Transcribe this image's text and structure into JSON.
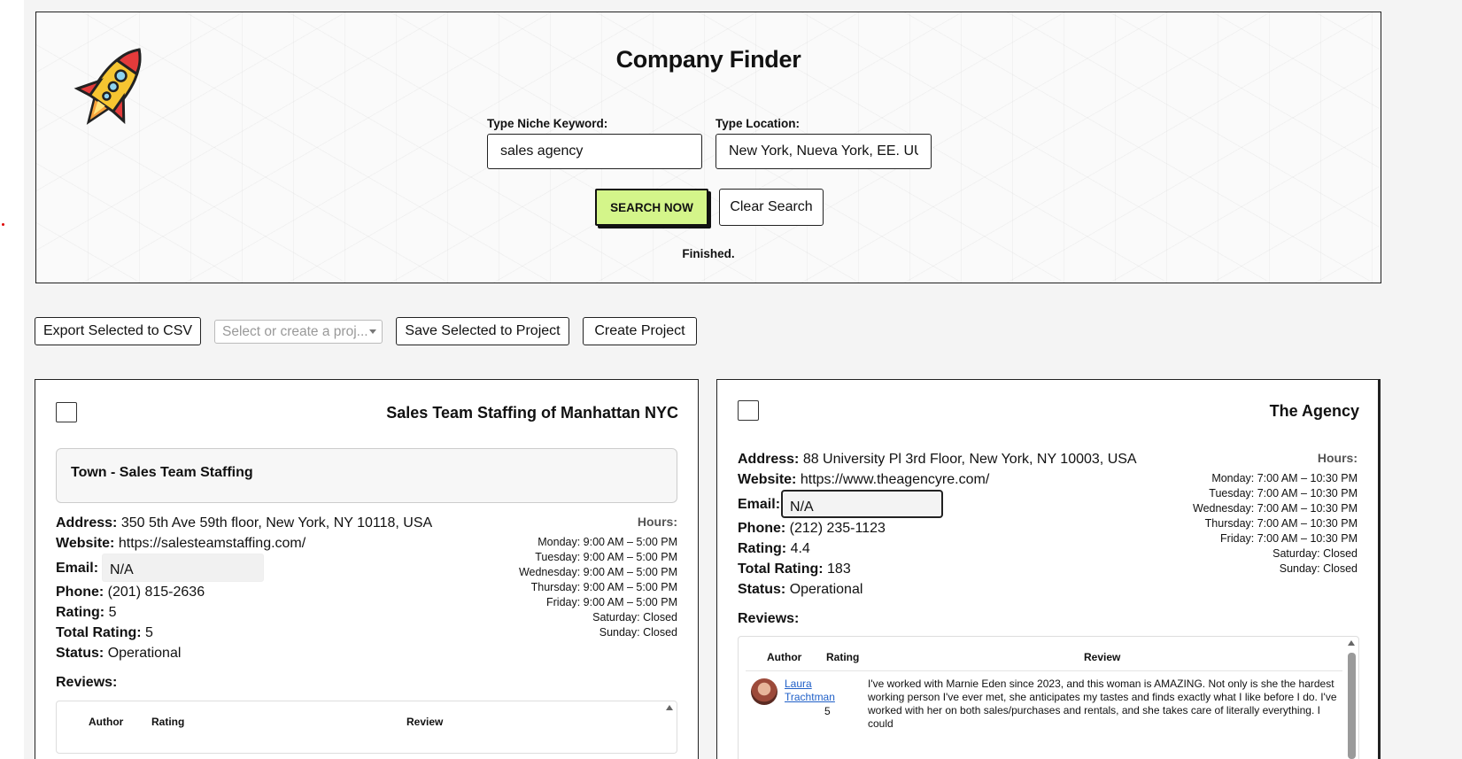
{
  "header": {
    "title": "Company Finder",
    "keyword_label": "Type Niche Keyword:",
    "keyword_value": "sales agency",
    "location_label": "Type Location:",
    "location_value": "New York, Nueva York, EE. UU.",
    "search_button": "SEARCH NOW",
    "clear_button": "Clear Search",
    "status": "Finished.",
    "logo_icon": "rocket-icon"
  },
  "toolbar": {
    "export_button": "Export Selected to CSV",
    "project_placeholder": "Select or create a proj...",
    "save_button": "Save Selected to Project",
    "create_button": "Create Project"
  },
  "labels": {
    "address": "Address:",
    "website": "Website:",
    "email": "Email:",
    "phone": "Phone:",
    "rating": "Rating:",
    "total_rating": "Total Rating:",
    "status": "Status:",
    "hours": "Hours:",
    "reviews": "Reviews:",
    "col_author": "Author",
    "col_rating": "Rating",
    "col_review": "Review"
  },
  "companies": [
    {
      "name": "Sales Team Staffing of Manhattan NYC",
      "town": "Town - Sales Team Staffing",
      "address": "350 5th Ave 59th floor, New York, NY 10118, USA",
      "website": "https://salesteamstaffing.com/",
      "email": "N/A",
      "phone": "(201) 815-2636",
      "rating": "5",
      "total_rating": "5",
      "status": "Operational",
      "hours": [
        "Monday: 9:00 AM – 5:00 PM",
        "Tuesday: 9:00 AM – 5:00 PM",
        "Wednesday: 9:00 AM – 5:00 PM",
        "Thursday: 9:00 AM – 5:00 PM",
        "Friday: 9:00 AM – 5:00 PM",
        "Saturday: Closed",
        "Sunday: Closed"
      ]
    },
    {
      "name": "The Agency",
      "address": "88 University Pl 3rd Floor, New York, NY 10003, USA",
      "website": "https://www.theagencyre.com/",
      "email": "N/A",
      "phone": "(212) 235-1123",
      "rating": "4.4",
      "total_rating": "183",
      "status": "Operational",
      "hours": [
        "Monday: 7:00 AM – 10:30 PM",
        "Tuesday: 7:00 AM – 10:30 PM",
        "Wednesday: 7:00 AM – 10:30 PM",
        "Thursday: 7:00 AM – 10:30 PM",
        "Friday: 7:00 AM – 10:30 PM",
        "Saturday: Closed",
        "Sunday: Closed"
      ],
      "reviews": [
        {
          "author": "Laura Trachtman",
          "rating": "5",
          "text": "I've worked with Marnie Eden since 2023, and this woman is AMAZING. Not only is she the hardest working person I've ever met, she anticipates my tastes and finds exactly what I like before I do. I've worked with her on both sales/purchases and rentals, and she takes care of literally everything. I could"
        }
      ]
    }
  ]
}
